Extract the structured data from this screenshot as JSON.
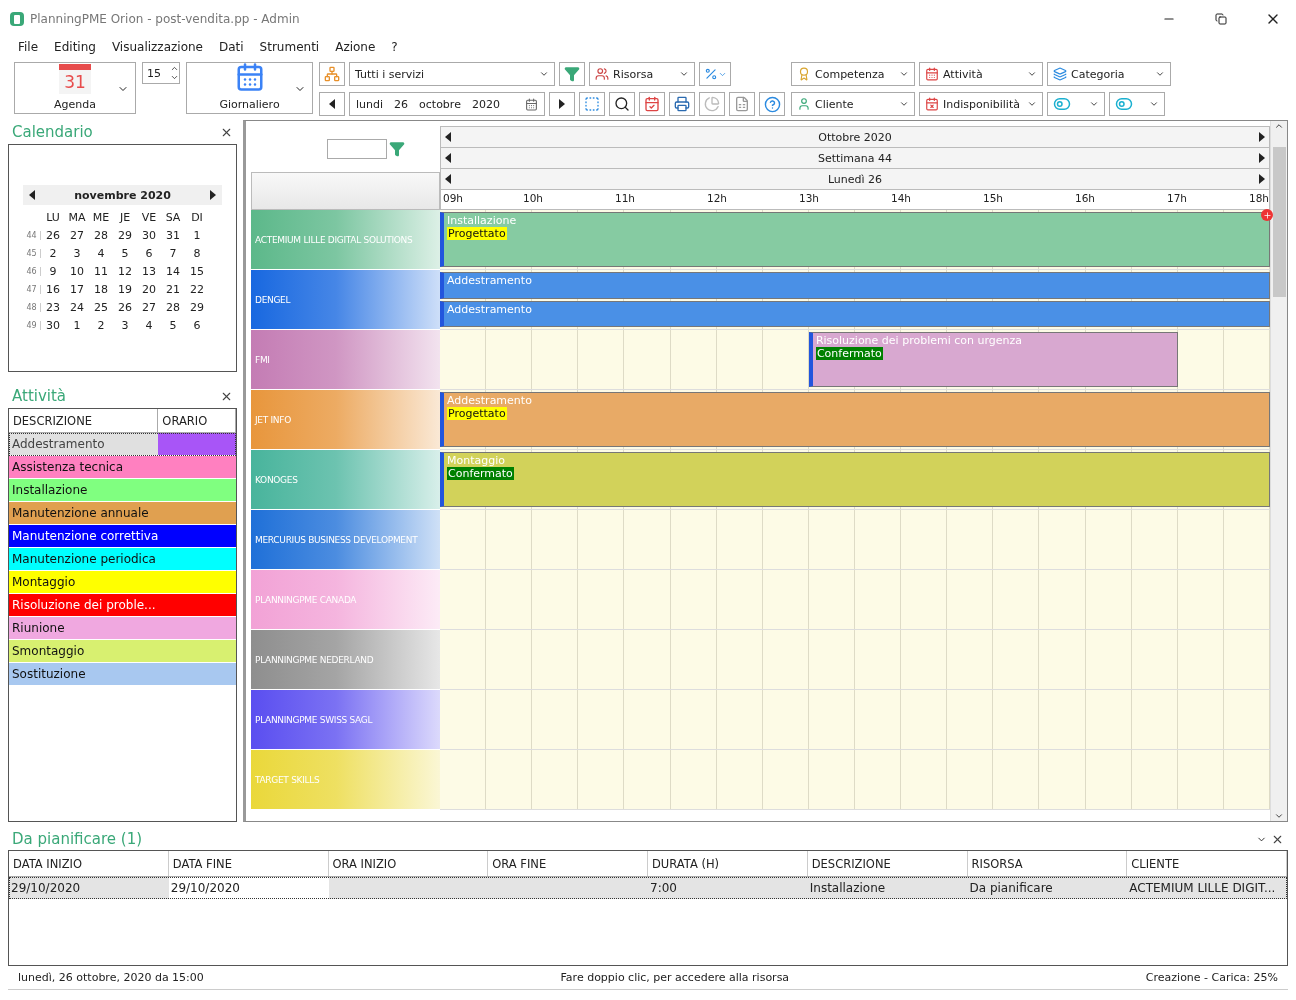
{
  "window": {
    "title": "PlanningPME Orion - post-vendita.pp - Admin"
  },
  "menu": [
    "File",
    "Editing",
    "Visualizzazione",
    "Dati",
    "Strumenti",
    "Azione",
    "?"
  ],
  "toolbar": {
    "agenda": {
      "day": "31",
      "label": "Agenda"
    },
    "spin_value": "15",
    "view": {
      "label": "Giornaliero"
    },
    "service_combo": "Tutti i servizi",
    "date": {
      "weekday": "lundi",
      "day": "26",
      "month": "octobre",
      "year": "2020"
    },
    "dropdowns_top": [
      "Risorsa",
      "Competenza",
      "Attività",
      "Categoria"
    ],
    "dropdowns_bottom": [
      "Cliente",
      "Indisponibilità"
    ]
  },
  "calendar_panel": {
    "title": "Calendario",
    "month": "novembre 2020",
    "weekdays": [
      "LU",
      "MA",
      "ME",
      "JE",
      "VE",
      "SA",
      "DI"
    ],
    "weeks": [
      {
        "number": "44",
        "days": [
          "26",
          "27",
          "28",
          "29",
          "30",
          "31",
          "1"
        ]
      },
      {
        "number": "45",
        "days": [
          "2",
          "3",
          "4",
          "5",
          "6",
          "7",
          "8"
        ]
      },
      {
        "number": "46",
        "days": [
          "9",
          "10",
          "11",
          "12",
          "13",
          "14",
          "15"
        ]
      },
      {
        "number": "47",
        "days": [
          "16",
          "17",
          "18",
          "19",
          "20",
          "21",
          "22"
        ]
      },
      {
        "number": "48",
        "days": [
          "23",
          "24",
          "25",
          "26",
          "27",
          "28",
          "29"
        ]
      },
      {
        "number": "49",
        "days": [
          "30",
          "1",
          "2",
          "3",
          "4",
          "5",
          "6"
        ]
      }
    ]
  },
  "activities_panel": {
    "title": "Attività",
    "columns": [
      "DESCRIZIONE",
      "ORARIO"
    ],
    "items": [
      {
        "label": "Addestramento",
        "color": "#a855f7",
        "selected": true
      },
      {
        "label": "Assistenza tecnica",
        "color": "#ff80c0",
        "selected": false
      },
      {
        "label": "Installazione",
        "color": "#80ff80",
        "selected": false
      },
      {
        "label": "Manutenzione annuale",
        "color": "#e0a050",
        "selected": false
      },
      {
        "label": "Manutenzione correttiva",
        "color": "#0000ff",
        "selected": false
      },
      {
        "label": "Manutenzione periodica",
        "color": "#00ffff",
        "selected": false
      },
      {
        "label": "Montaggio",
        "color": "#ffff00",
        "selected": false
      },
      {
        "label": "Risoluzione dei proble...",
        "color": "#ff0000",
        "selected": false
      },
      {
        "label": "Riunione",
        "color": "#f0a8e0",
        "selected": false
      },
      {
        "label": "Smontaggio",
        "color": "#d8f070",
        "selected": false
      },
      {
        "label": "Sostituzione",
        "color": "#a8c8f0",
        "selected": false
      }
    ]
  },
  "planner": {
    "month": "Ottobre 2020",
    "week": "Settimana 44",
    "day": "Lunedì 26",
    "hours": [
      "09h",
      "10h",
      "11h",
      "12h",
      "13h",
      "14h",
      "15h",
      "16h",
      "17h",
      "18h"
    ],
    "resources": [
      {
        "name": "ACTEMIUM LILLE DIGITAL SOLUTIONS",
        "color": "#5cb88a",
        "events": [
          {
            "kind": "all_day",
            "title": "Installazione",
            "color": "#86cba2",
            "tag": {
              "label": "Progettato",
              "color": "#ffff00"
            }
          }
        ]
      },
      {
        "name": "DENGEL",
        "color": "#1868e0",
        "events": [
          {
            "kind": "all_day",
            "title": "Addestramento",
            "color": "#4a90e6"
          },
          {
            "kind": "all_day",
            "title": "Addestramento",
            "color": "#4a90e6"
          }
        ]
      },
      {
        "name": "FMI",
        "color": "#c47cb4",
        "events": [
          {
            "kind": "afternoon",
            "title": "Risoluzione dei problemi con urgenza",
            "color": "#d8a8d0",
            "tag": {
              "label": "Confermato",
              "color": "#008000"
            }
          }
        ]
      },
      {
        "name": "JET INFO",
        "color": "#e8963c",
        "events": [
          {
            "kind": "all_day",
            "title": "Addestramento",
            "color": "#e8aa66",
            "tag": {
              "label": "Progettato",
              "color": "#ffff00"
            }
          }
        ]
      },
      {
        "name": "KONOGES",
        "color": "#48b49c",
        "events": [
          {
            "kind": "all_day",
            "title": "Montaggio",
            "color": "#d2d25a",
            "tag": {
              "label": "Confermato",
              "color": "#008000"
            }
          }
        ]
      },
      {
        "name": "MERCURIUS BUSINESS DEVELOPMENT",
        "color": "#1f70d8"
      },
      {
        "name": "PLANNINGPME CANADA",
        "color": "#f2a2d6"
      },
      {
        "name": "PLANNINGPME NEDERLAND",
        "color": "#8e8e8e"
      },
      {
        "name": "PLANNINGPME SWISS SAGL",
        "color": "#5a4ef0"
      },
      {
        "name": "TARGET SKILLS",
        "color": "#ead83a"
      }
    ]
  },
  "unplanned_panel": {
    "title": "Da pianificare (1)",
    "columns": [
      "DATA INIZIO",
      "DATA FINE",
      "ORA INIZIO",
      "ORA FINE",
      "DURATA (H)",
      "DESCRIZIONE",
      "RISORSA",
      "CLIENTE"
    ],
    "rows": [
      {
        "selected": true,
        "cells": [
          "29/10/2020",
          "29/10/2020",
          null,
          null,
          "7:00",
          "Installazione",
          "Da pianificare",
          "ACTEMIUM LILLE DIGIT..."
        ]
      }
    ]
  },
  "status_bar": {
    "left": "lunedì, 26 ottobre, 2020 da 15:00",
    "center": "Fare doppio clic, per accedere alla risorsa",
    "right": "Creazione - Carica: 25%"
  }
}
